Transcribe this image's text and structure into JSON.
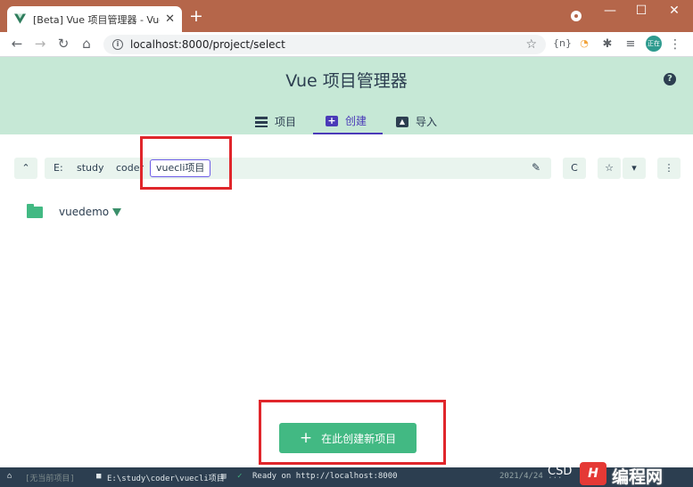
{
  "browser": {
    "tab_title": "[Beta] Vue 项目管理器 - Vue Cl",
    "tab_close": "✕",
    "new_tab": "+",
    "url": "localhost:8000/project/select",
    "window_minimize": "—",
    "window_maximize": "☐",
    "window_close": "✕",
    "toolbar_icons": [
      "star-icon",
      "extension-icon",
      "refresh-circle-icon",
      "puzzle-icon",
      "reading-list-icon"
    ],
    "profile_label": "正在",
    "ext_label": "{n}"
  },
  "app": {
    "title": "Vue 项目管理器",
    "help": "?",
    "tabs": [
      {
        "label": "项目",
        "icon": "list-icon",
        "active": false
      },
      {
        "label": "创建",
        "icon": "plus-box-icon",
        "active": true
      },
      {
        "label": "导入",
        "icon": "import-icon",
        "active": false
      }
    ]
  },
  "toolbar": {
    "up": "⌃",
    "crumbs": [
      "E:",
      "study",
      "coder",
      "vuecli项目"
    ],
    "edit": "✎",
    "refresh": "C",
    "favorite": "☆",
    "dropdown": "▾",
    "more": "⋮"
  },
  "folders": [
    {
      "name": "vuedemo",
      "is_vue_project": true
    }
  ],
  "create_button": {
    "icon": "+",
    "label": "在此创建新项目"
  },
  "statusbar": {
    "left_label": "[无当前项目]",
    "path": "E:\\study\\coder\\vuecli项目",
    "log": "Ready on http://localhost:8000",
    "time": "2021/4/24 ..."
  },
  "watermark": {
    "csdn": "CSD",
    "logo": "H",
    "text": "编程网"
  },
  "colors": {
    "tab_strip": "#b5664a",
    "header_bg": "#c6e8d6",
    "accent": "#4a3ab8",
    "vue_green": "#42b983",
    "annotation_red": "#e0262b"
  }
}
